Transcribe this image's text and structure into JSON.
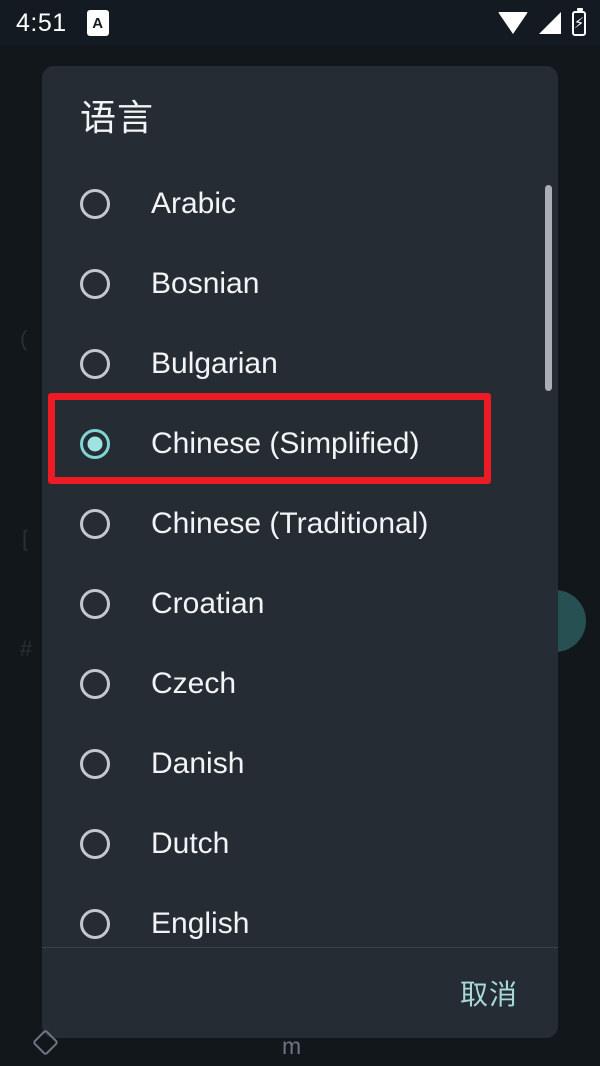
{
  "status_bar": {
    "time": "4:51",
    "notification_icon": "app-letter-a-icon",
    "notification_letter": "A",
    "icons": [
      "wifi-icon",
      "cellular-signal-icon",
      "battery-charging-icon"
    ]
  },
  "nav_bar": {
    "back_icon": "back-diamond-icon",
    "home_label": "m"
  },
  "dialog": {
    "title": "语言",
    "selected_value": "Chinese (Simplified)",
    "options": [
      {
        "label": "Arabic",
        "selected": false
      },
      {
        "label": "Bosnian",
        "selected": false
      },
      {
        "label": "Bulgarian",
        "selected": false
      },
      {
        "label": "Chinese (Simplified)",
        "selected": true
      },
      {
        "label": "Chinese (Traditional)",
        "selected": false
      },
      {
        "label": "Croatian",
        "selected": false
      },
      {
        "label": "Czech",
        "selected": false
      },
      {
        "label": "Danish",
        "selected": false
      },
      {
        "label": "Dutch",
        "selected": false
      },
      {
        "label": "English",
        "selected": false
      }
    ],
    "cancel_label": "取消"
  },
  "annotation": {
    "target": "Chinese (Simplified)",
    "color": "#ed1c24"
  },
  "colors": {
    "dialog_background": "#262c33",
    "scrim": "#0c0f12",
    "status_bar": "#141a21",
    "accent_teal": "#a8d8d8",
    "radio_selected": "#7fd4d4",
    "text_primary": "#f2f4f6",
    "annotation_red": "#ed1c24"
  }
}
